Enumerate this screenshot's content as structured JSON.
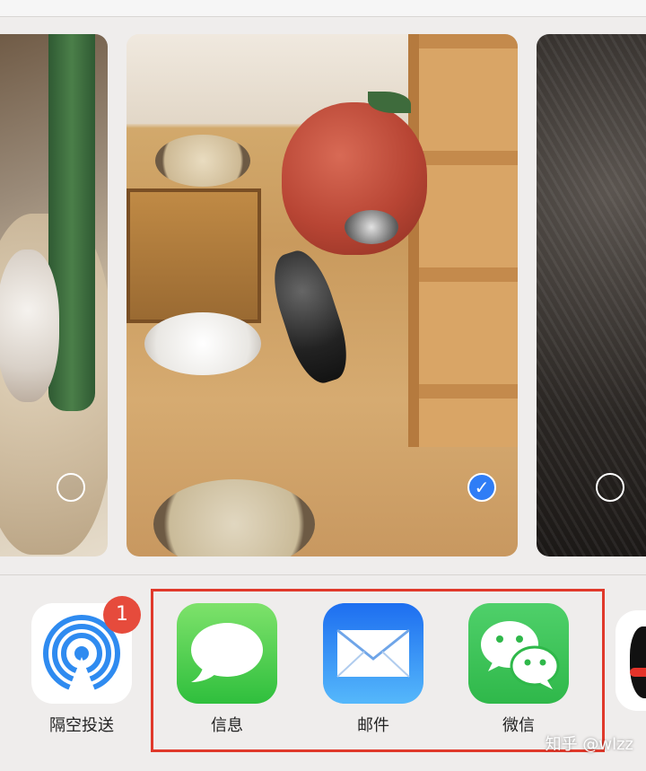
{
  "share_sheet": {
    "photos": [
      {
        "selected": false
      },
      {
        "selected": true,
        "check_glyph": "✓"
      },
      {
        "selected": false
      }
    ],
    "apps": [
      {
        "label": "隔空投送",
        "icon": "airdrop-icon",
        "badge": "1"
      },
      {
        "label": "信息",
        "icon": "messages-icon"
      },
      {
        "label": "邮件",
        "icon": "mail-icon"
      },
      {
        "label": "微信",
        "icon": "wechat-icon"
      }
    ],
    "partial_app_icon": "qq-penguin-icon",
    "highlight_color": "#e0392b"
  },
  "watermark": "知乎 @wlzz",
  "colors": {
    "checked": "#2f7df6",
    "badge": "#e64b3c",
    "messages": "#4cd964",
    "mail": "#1e7cf2",
    "wechat": "#41c15b"
  }
}
